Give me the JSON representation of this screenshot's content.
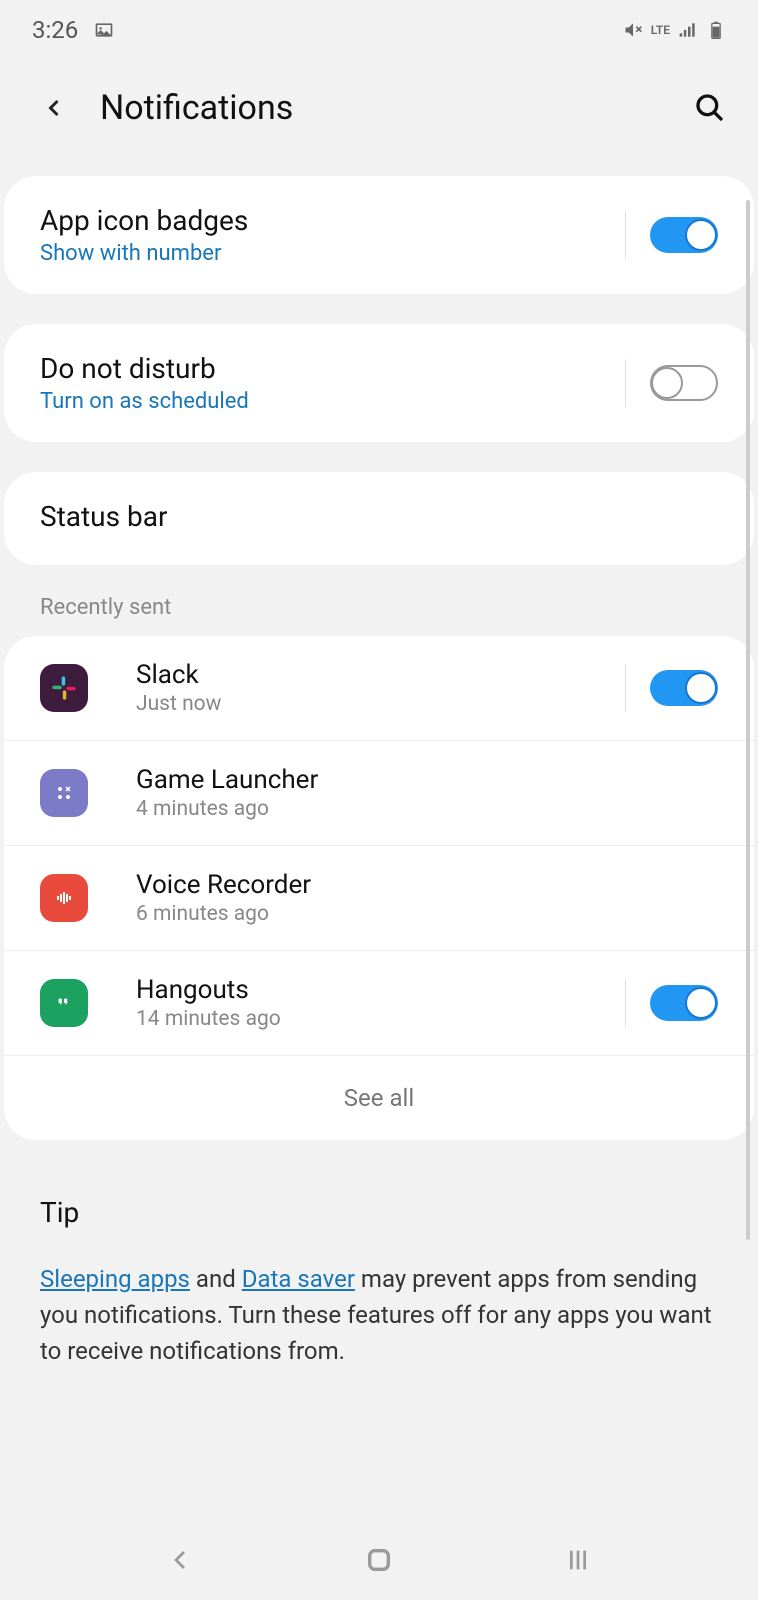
{
  "statusbar": {
    "time": "3:26",
    "network": "LTE"
  },
  "header": {
    "title": "Notifications"
  },
  "settings": {
    "app_badges": {
      "title": "App icon badges",
      "subtitle": "Show with number",
      "enabled": true
    },
    "dnd": {
      "title": "Do not disturb",
      "subtitle": "Turn on as scheduled",
      "enabled": false
    },
    "status_bar": {
      "title": "Status bar"
    }
  },
  "recent": {
    "header": "Recently sent",
    "apps": [
      {
        "name": "Slack",
        "time": "Just now",
        "icon": "slack",
        "toggle": true,
        "enabled": true
      },
      {
        "name": "Game Launcher",
        "time": "4 minutes ago",
        "icon": "game",
        "toggle": false
      },
      {
        "name": "Voice Recorder",
        "time": "6 minutes ago",
        "icon": "voice",
        "toggle": false
      },
      {
        "name": "Hangouts",
        "time": "14 minutes ago",
        "icon": "hangouts",
        "toggle": true,
        "enabled": true
      }
    ],
    "see_all": "See all"
  },
  "tip": {
    "title": "Tip",
    "link1": "Sleeping apps",
    "mid1": " and ",
    "link2": "Data saver",
    "rest": " may prevent apps from sending you notifications. Turn these features off for any apps you want to receive notifications from."
  }
}
